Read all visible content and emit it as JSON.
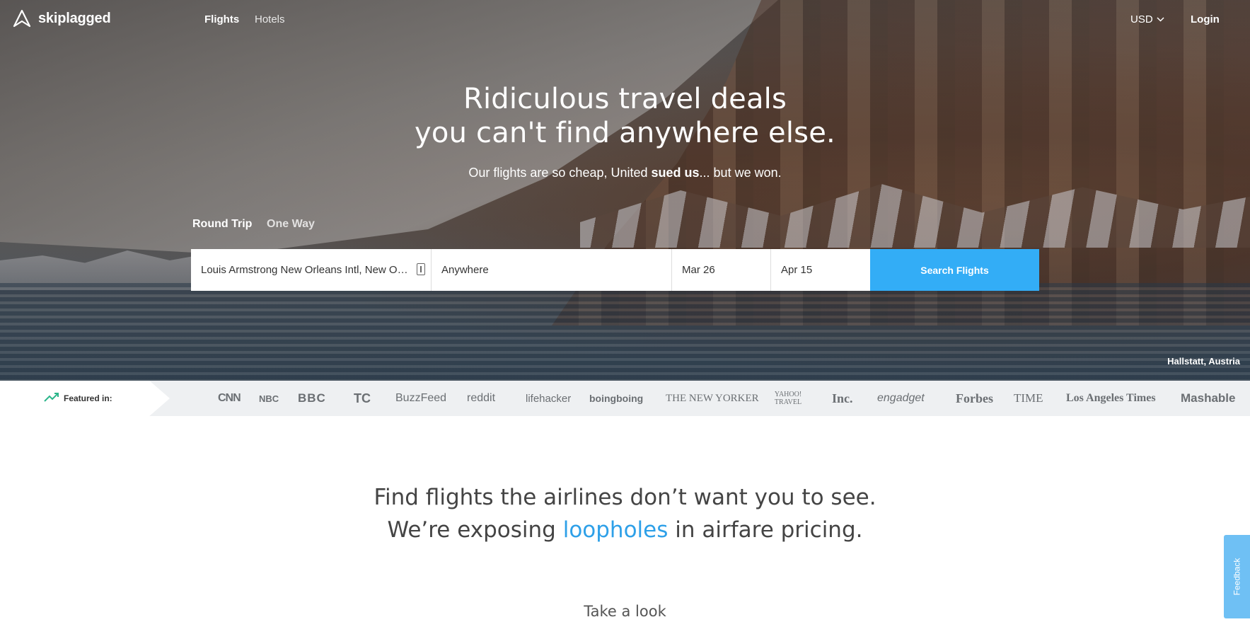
{
  "nav": {
    "brand": "skiplagged",
    "links": [
      "Flights",
      "Hotels"
    ],
    "currency": "USD",
    "login": "Login"
  },
  "hero": {
    "headline_line1": "Ridiculous travel deals",
    "headline_line2": "you can't find anywhere else.",
    "subhead_before": "Our flights are so cheap, United ",
    "subhead_bold": "sued us",
    "subhead_after": "... but we won.",
    "location": "Hallstatt, Austria"
  },
  "trip_types": [
    "Round Trip",
    "One Way"
  ],
  "search": {
    "from": "Louis Armstrong New Orleans Intl, New Orleans",
    "to": "Anywhere",
    "depart": "Mar 26",
    "return": "Apr 15",
    "button": "Search Flights"
  },
  "featured": {
    "label": "Featured in:",
    "outlets": [
      "CNN",
      "NBC",
      "BBC",
      "TC",
      "BuzzFeed",
      "reddit",
      "lifehacker",
      "boingboing",
      "THE NEW YORKER",
      "YAHOO! TRAVEL",
      "Inc.",
      "engadget",
      "Forbes",
      "TIME",
      "Los Angeles Times",
      "Mashable"
    ]
  },
  "tagline": {
    "line1": "Find flights the airlines don’t want you to see.",
    "line2_before": "We’re exposing ",
    "line2_highlight": "loopholes",
    "line2_after": " in airfare pricing."
  },
  "take_look": "Take a look",
  "feedback": "Feedback",
  "colors": {
    "accent": "#33adf6",
    "highlight": "#2ea0e8",
    "trend": "#2bb58a"
  }
}
